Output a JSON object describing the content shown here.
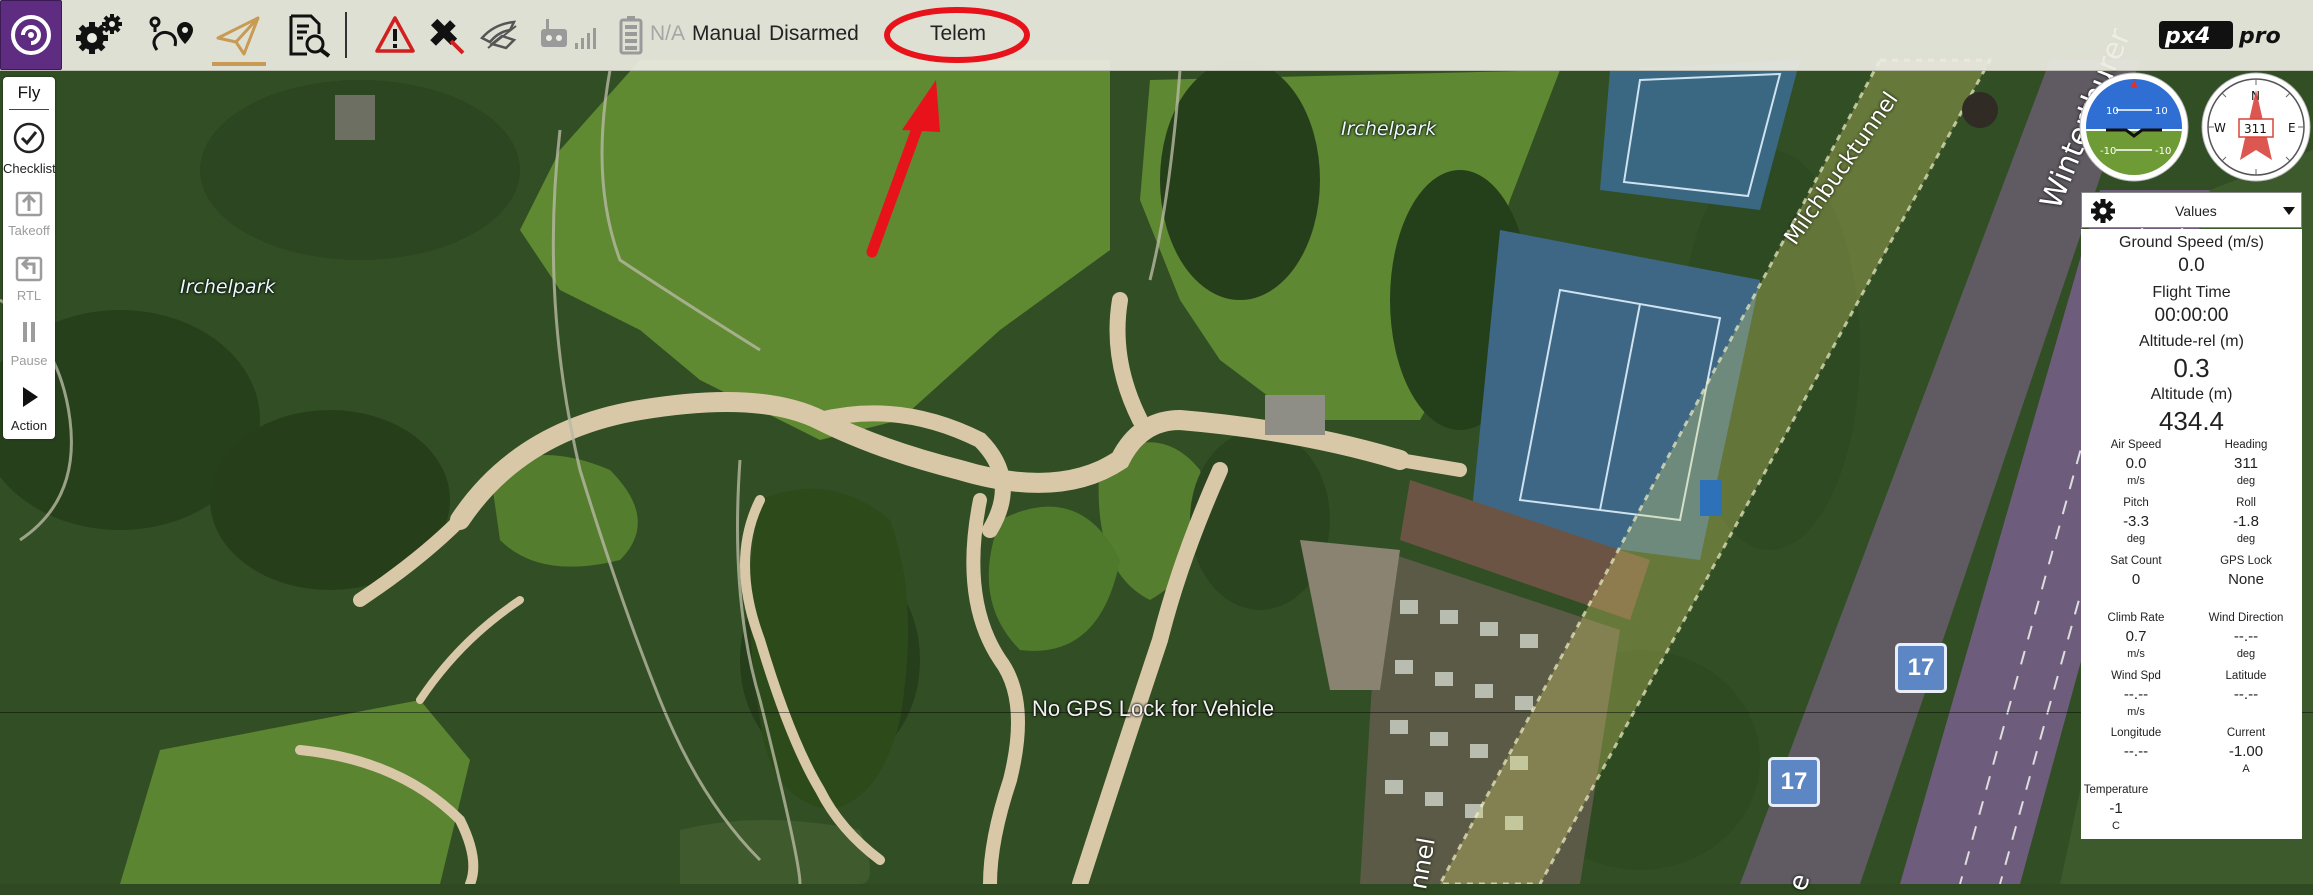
{
  "toolbar": {
    "battery_text": "N/A",
    "flight_mode": "Manual",
    "arm_state": "Disarmed",
    "telem_label": "Telem",
    "brand_logo": "px4 pro",
    "icons": [
      "app-logo-icon",
      "settings-gears-icon",
      "plan-route-icon",
      "fly-paper-plane-icon",
      "analyze-icon",
      "warning-icon",
      "vehicle-gps-icon",
      "signal-bars-icon",
      "rc-transmitter-icon",
      "battery-icon"
    ],
    "annotation_color": "#e8121b"
  },
  "toolstrip": {
    "items": [
      {
        "label": "Fly",
        "icon": "",
        "enabled": true
      },
      {
        "label": "Checklist",
        "icon": "checkmark-circle-icon",
        "enabled": true
      },
      {
        "label": "Takeoff",
        "icon": "takeoff-icon",
        "enabled": false
      },
      {
        "label": "RTL",
        "icon": "return-icon",
        "enabled": false
      },
      {
        "label": "Pause",
        "icon": "pause-icon",
        "enabled": false
      },
      {
        "label": "Action",
        "icon": "play-icon",
        "enabled": true
      }
    ]
  },
  "map": {
    "labels": {
      "park_left": "Irchelpark",
      "park_top": "Irchelpark",
      "road_tunnel": "Milchbucktunnel",
      "road_right": "Winterthurer",
      "road_bottom": "nnel",
      "road_bottom_right": "e"
    },
    "route_shields": [
      "17",
      "17"
    ],
    "status_message": "No GPS Lock for Vehicle"
  },
  "instruments": {
    "attitude_marks": [
      "10",
      "10",
      "-10",
      "-10"
    ],
    "compass_heading": "311",
    "compass_letters": [
      "N",
      "E",
      "W"
    ]
  },
  "values_panel": {
    "header_label": "Values",
    "big": [
      {
        "label": "Ground Speed (m/s)",
        "value": "0.0"
      },
      {
        "label": "Flight Time",
        "value": "00:00:00"
      },
      {
        "label": "Altitude-rel (m)",
        "value": "0.3"
      },
      {
        "label": "Altitude (m)",
        "value": "434.4"
      }
    ],
    "grid": [
      {
        "label": "Air Speed",
        "value": "0.0",
        "unit": "m/s"
      },
      {
        "label": "Heading",
        "value": "311",
        "unit": "deg"
      },
      {
        "label": "Pitch",
        "value": "-3.3",
        "unit": "deg"
      },
      {
        "label": "Roll",
        "value": "-1.8",
        "unit": "deg"
      },
      {
        "label": "Sat Count",
        "value": "0",
        "unit": ""
      },
      {
        "label": "GPS Lock",
        "value": "None",
        "unit": ""
      },
      {
        "label": "Climb Rate",
        "value": "0.7",
        "unit": "m/s"
      },
      {
        "label": "Wind Direction",
        "value": "--.--",
        "unit": "deg"
      },
      {
        "label": "Wind Spd",
        "value": "--.--",
        "unit": "m/s"
      },
      {
        "label": "Latitude",
        "value": "--.--",
        "unit": ""
      },
      {
        "label": "Longitude",
        "value": "--.--",
        "unit": ""
      },
      {
        "label": "Current",
        "value": "-1.00",
        "unit": "A"
      },
      {
        "label": "Temperature",
        "value": "-1",
        "unit": "C"
      }
    ]
  }
}
